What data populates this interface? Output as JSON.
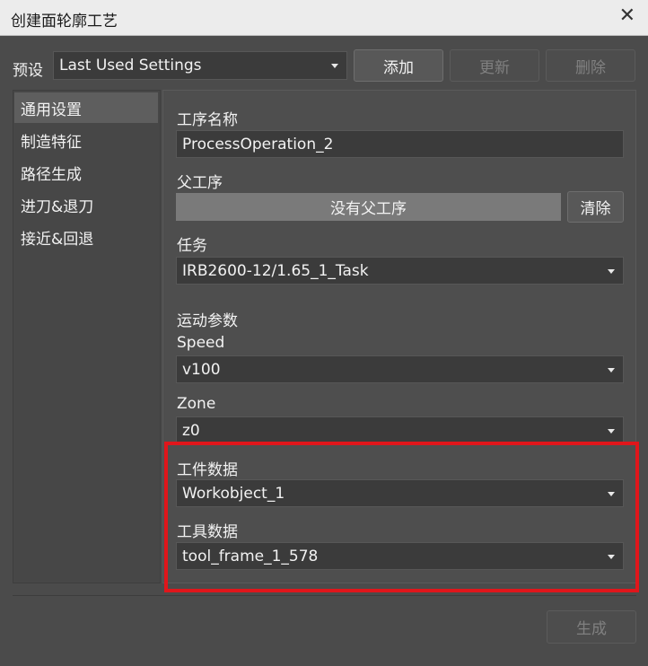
{
  "window": {
    "title": "创建面轮廓工艺",
    "close_icon": "close-icon"
  },
  "presets": {
    "label": "预设",
    "selected": "Last Used Settings",
    "add_label": "添加",
    "update_label": "更新",
    "delete_label": "删除"
  },
  "sidebar": {
    "items": [
      {
        "label": "通用设置",
        "active": true
      },
      {
        "label": "制造特征",
        "active": false
      },
      {
        "label": "路径生成",
        "active": false
      },
      {
        "label": "进刀&退刀",
        "active": false
      },
      {
        "label": "接近&回退",
        "active": false
      }
    ]
  },
  "general": {
    "op_name_label": "工序名称",
    "op_name_value": "ProcessOperation_2",
    "parent_label": "父工序",
    "parent_value": "没有父工序",
    "clear_label": "清除",
    "task_label": "任务",
    "task_value": "IRB2600-12/1.65_1_Task",
    "motion_label": "运动参数",
    "speed_label": "Speed",
    "speed_value": "v100",
    "zone_label": "Zone",
    "zone_value": "z0",
    "wobj_label": "工件数据",
    "wobj_value": "Workobject_1",
    "tool_label": "工具数据",
    "tool_value": "tool_frame_1_578"
  },
  "footer": {
    "generate_label": "生成"
  },
  "colors": {
    "highlight": "#e0161b",
    "background": "#4b4b4b"
  }
}
